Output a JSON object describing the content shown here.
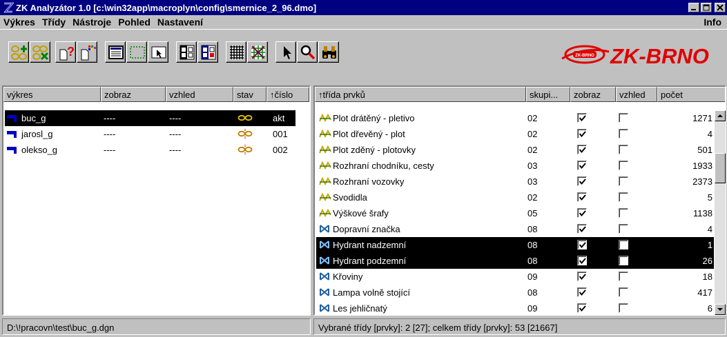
{
  "window": {
    "title": "ZK Analyzátor 1.0  [c:\\win32app\\macroplyn\\config\\smernice_2_96.dmo]",
    "controls": [
      "minimize",
      "maximize",
      "close"
    ]
  },
  "menu": {
    "items": [
      "Výkres",
      "Třídy",
      "Nástroje",
      "Pohled",
      "Nastavení"
    ],
    "info": "Info"
  },
  "toolbar": {
    "buttons": [
      "add-drawing-icon",
      "remove-drawing-icon",
      "help-icon",
      "color-palette-icon",
      "list-view-icon",
      "select-rectangle-icon",
      "pointer-select-icon",
      "check-all-icon",
      "check-selected-icon",
      "grid-icon",
      "cross-grid-icon",
      "arrow-cursor-icon",
      "zoom-icon",
      "binoculars-icon"
    ],
    "logo_text": "ZK-BRNO",
    "logo_badge": "ZK-BRNO"
  },
  "drawings": {
    "columns": [
      "výkres",
      "zobraz",
      "vzhled",
      "stav",
      "↑číslo"
    ],
    "rows": [
      {
        "name": "buc_g",
        "zobraz": "----",
        "vzhled": "----",
        "stav_icon": "chain-icon",
        "cislo": "akt",
        "selected": true
      },
      {
        "name": "jarosl_g",
        "zobraz": "----",
        "vzhled": "----",
        "stav_icon": "chain-broken-icon",
        "cislo": "001",
        "selected": false
      },
      {
        "name": "olekso_g",
        "zobraz": "----",
        "vzhled": "----",
        "stav_icon": "chain-broken-icon",
        "cislo": "002",
        "selected": false
      }
    ]
  },
  "classes": {
    "columns": [
      "↑třída prvků",
      "skupi...",
      "zobraz",
      "vzhled",
      "počet"
    ],
    "rows": [
      {
        "icon": "line-style-icon",
        "name": "Plot drátěný - pletivo",
        "group": "02",
        "zobraz": true,
        "vzhled": false,
        "count": "1271",
        "selected": false
      },
      {
        "icon": "line-style-icon",
        "name": "Plot dřevěný - plot",
        "group": "02",
        "zobraz": true,
        "vzhled": false,
        "count": "4",
        "selected": false
      },
      {
        "icon": "line-style-icon",
        "name": "Plot zděný - plotovky",
        "group": "02",
        "zobraz": true,
        "vzhled": false,
        "count": "501",
        "selected": false
      },
      {
        "icon": "line-style-icon",
        "name": "Rozhraní chodníku, cesty",
        "group": "03",
        "zobraz": true,
        "vzhled": false,
        "count": "1933",
        "selected": false
      },
      {
        "icon": "line-style-icon",
        "name": "Rozhraní vozovky",
        "group": "03",
        "zobraz": true,
        "vzhled": false,
        "count": "2373",
        "selected": false
      },
      {
        "icon": "line-style-icon",
        "name": "Svodidla",
        "group": "02",
        "zobraz": true,
        "vzhled": false,
        "count": "5",
        "selected": false
      },
      {
        "icon": "line-style-icon",
        "name": "Výškové šrafy",
        "group": "05",
        "zobraz": true,
        "vzhled": false,
        "count": "1138",
        "selected": false
      },
      {
        "icon": "cell-symbol-icon",
        "name": "Dopravní značka",
        "group": "08",
        "zobraz": true,
        "vzhled": false,
        "count": "4",
        "selected": false
      },
      {
        "icon": "cell-symbol-icon",
        "name": "Hydrant nadzemní",
        "group": "08",
        "zobraz": true,
        "vzhled": false,
        "count": "1",
        "selected": true
      },
      {
        "icon": "cell-symbol-icon",
        "name": "Hydrant podzemní",
        "group": "08",
        "zobraz": true,
        "vzhled": false,
        "count": "26",
        "selected": true
      },
      {
        "icon": "cell-symbol-icon",
        "name": "Křoviny",
        "group": "09",
        "zobraz": true,
        "vzhled": false,
        "count": "18",
        "selected": false
      },
      {
        "icon": "cell-symbol-icon",
        "name": "Lampa volně stojící",
        "group": "08",
        "zobraz": true,
        "vzhled": false,
        "count": "417",
        "selected": false
      },
      {
        "icon": "cell-symbol-icon",
        "name": "Les jehličnatý",
        "group": "09",
        "zobraz": true,
        "vzhled": false,
        "count": "6",
        "selected": false
      }
    ]
  },
  "status": {
    "left": "D:\\!pracovn\\test\\buc_g.dgn",
    "right": "Vybrané třídy [prvky]: 2 [27];  celkem třídy [prvky]: 53 [21667]"
  },
  "colors": {
    "titlebar": "#000080",
    "selection": "#000000",
    "logo_red": "#e00000",
    "line_icon": "#d0a000",
    "cell_icon": "#2060a0"
  }
}
